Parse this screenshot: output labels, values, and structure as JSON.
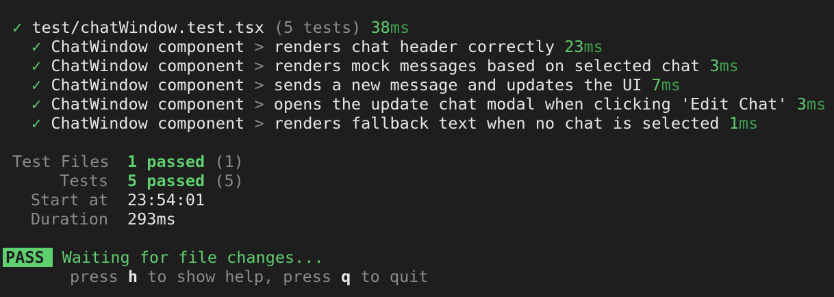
{
  "file": {
    "check": "✓",
    "path": "test/chatWindow.test.tsx",
    "count": "(5 tests)",
    "time_value": "38",
    "time_unit": "ms"
  },
  "tests": [
    {
      "check": "✓",
      "suite": "ChatWindow component",
      "sep": ">",
      "name": "renders chat header correctly",
      "time_value": "23",
      "time_unit": "ms"
    },
    {
      "check": "✓",
      "suite": "ChatWindow component",
      "sep": ">",
      "name": "renders mock messages based on selected chat",
      "time_value": "3",
      "time_unit": "ms"
    },
    {
      "check": "✓",
      "suite": "ChatWindow component",
      "sep": ">",
      "name": "sends a new message and updates the UI",
      "time_value": "7",
      "time_unit": "ms"
    },
    {
      "check": "✓",
      "suite": "ChatWindow component",
      "sep": ">",
      "name": "opens the update chat modal when clicking 'Edit Chat'",
      "time_value": "3",
      "time_unit": "ms"
    },
    {
      "check": "✓",
      "suite": "ChatWindow component",
      "sep": ">",
      "name": "renders fallback text when no chat is selected",
      "time_value": "1",
      "time_unit": "ms"
    }
  ],
  "summary": {
    "test_files": {
      "label": "Test Files",
      "passed": "1 passed",
      "total": "(1)"
    },
    "tests": {
      "label": "Tests",
      "passed": "5 passed",
      "total": "(5)"
    },
    "start_at": {
      "label": "Start at",
      "value": "23:54:01"
    },
    "duration": {
      "label": "Duration",
      "value": "293ms"
    }
  },
  "status": {
    "badge": "PASS",
    "message": "Waiting for file changes...",
    "help_prefix": "press ",
    "help_key": "h",
    "help_mid": " to show help, press ",
    "quit_key": "q",
    "help_suffix": " to quit"
  },
  "colors": {
    "background": "#1e1e1e",
    "pass_green": "#5fcf6f",
    "dim_text": "#8a8a8a"
  }
}
